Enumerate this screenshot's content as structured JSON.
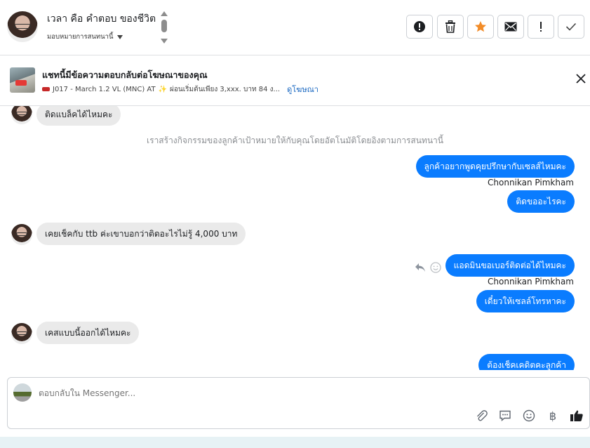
{
  "header": {
    "contact_name": "เวลา คือ คำตอบ ของชีวิต",
    "assign_label": "มอบหมายการสนทนานี้",
    "actions": [
      {
        "name": "mark-spam-button",
        "icon": "alert-circle-icon"
      },
      {
        "name": "delete-button",
        "icon": "trash-icon"
      },
      {
        "name": "star-button",
        "icon": "star-icon"
      },
      {
        "name": "mark-unread-button",
        "icon": "envelope-icon"
      },
      {
        "name": "follow-up-button",
        "icon": "exclamation-icon"
      },
      {
        "name": "mark-done-button",
        "icon": "checkmark-icon"
      }
    ]
  },
  "ad_banner": {
    "title": "แชทนี้มีข้อความตอบกลับต่อโฆษณาของคุณ",
    "subtitle": "J017 - March 1.2 VL (MNC) AT",
    "subtitle_extra": "ผ่อนเริ่มต้นเพียง 3,xxx. บาท 84 ง...",
    "view_ad_link": "ดูโฆษณา"
  },
  "messages": {
    "m1": "ติดแบล็คได้ไหมคะ",
    "system_note": "เราสร้างกิจกรรมของลูกค้าเป้าหมายให้กับคุณโดยอัตโนมัติโดยอิงตามการสนทนานี้",
    "m2": "ลูกค้าอยากพูดคุยปรึกษากับเซลส์ไหมคะ",
    "sender1": "Chonnikan Pimkham",
    "m3": "ติดขออะไรคะ",
    "m4": "เคยเช็คกับ ttb ค่ะเขาบอกว่าติดอะไรไม่รู้ 4,000 บาท",
    "m5": "แอดมินขอเบอร์ติดต่อได้ไหมคะ",
    "sender2": "Chonnikan Pimkham",
    "m6": "เดี๋ยวให้เซลล์โทรหาคะ",
    "m7": "เคสแบบนี้ออกได้ไหมคะ",
    "m8": "ต้องเช็คเคดิตคะลูกค้า"
  },
  "composer": {
    "placeholder": "ตอบกลับใน Messenger...",
    "baht_symbol": "฿"
  },
  "colors": {
    "outgoing_bubble": "#0a7cff",
    "incoming_bubble": "#eaeaea",
    "star": "#f28c28"
  }
}
